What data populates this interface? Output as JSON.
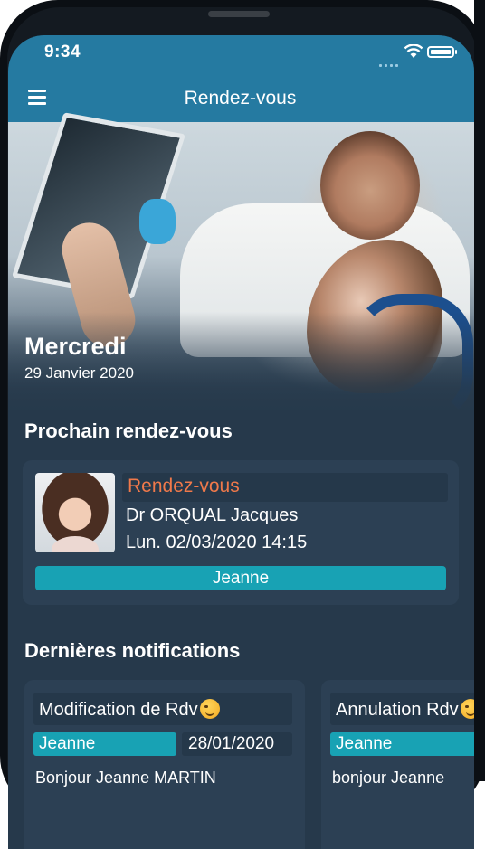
{
  "status": {
    "time": "9:34"
  },
  "nav": {
    "title": "Rendez-vous"
  },
  "hero": {
    "day": "Mercredi",
    "date": "29 Janvier 2020"
  },
  "next": {
    "title": "Prochain rendez-vous",
    "type": "Rendez-vous",
    "doctor": "Dr ORQUAL Jacques",
    "datetime": "Lun. 02/03/2020 14:15",
    "patient": "Jeanne"
  },
  "notifications": {
    "title": "Dernières notifications",
    "items": [
      {
        "title": "Modification de Rdv",
        "patient": "Jeanne",
        "date": "28/01/2020",
        "body": "Bonjour Jeanne MARTIN"
      },
      {
        "title": "Annulation Rdv",
        "patient": "Jeanne",
        "date": "",
        "body": "bonjour Jeanne"
      }
    ]
  },
  "colors": {
    "header": "#257aa1",
    "accent": "#18a2b4",
    "appointment_type": "#f0794a",
    "background": "#26394b"
  }
}
